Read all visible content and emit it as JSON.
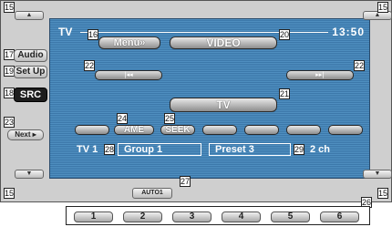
{
  "screen": {
    "title": "TV",
    "time": "13:50",
    "menu_button": "Menu»",
    "video_button": "VIDEO",
    "prev_button": "|◂◂",
    "next_button": "▸▸|",
    "source_button": "TV",
    "ame_button": "AME",
    "seek_button": "SEEK",
    "band": "TV 1",
    "group": "Group 1",
    "preset": "Preset 3",
    "channel": "2 ch"
  },
  "left_panel": {
    "audio": "Audio",
    "setup": "Set Up",
    "src": "SRC",
    "next": "Next ▸"
  },
  "auto_button": "AUTO1",
  "presets": [
    "1",
    "2",
    "3",
    "4",
    "5",
    "6"
  ],
  "callouts": [
    "15",
    "16",
    "17",
    "18",
    "19",
    "20",
    "21",
    "22",
    "23",
    "24",
    "25",
    "26",
    "27",
    "28",
    "29"
  ]
}
